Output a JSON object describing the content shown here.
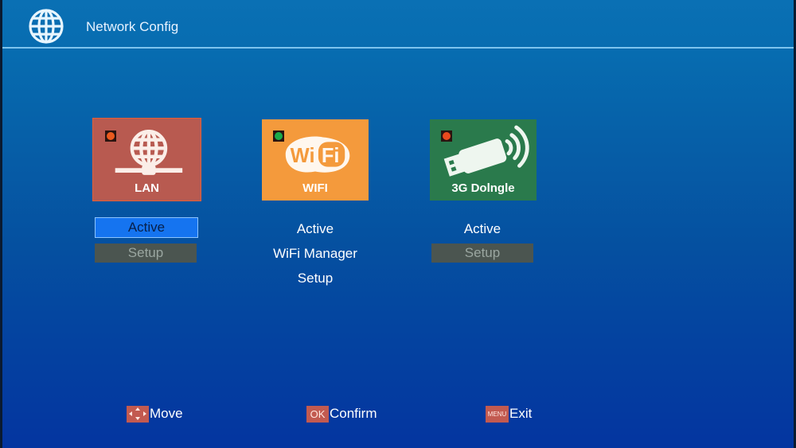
{
  "header": {
    "title": "Network Config",
    "icon": "globe-icon"
  },
  "tiles": [
    {
      "label": "LAN",
      "icon": "lan-globe-icon",
      "color": "#b85a50",
      "status_color": "#ea5a1e",
      "selected": true,
      "options": [
        "Active",
        "Setup"
      ]
    },
    {
      "label": "WIFI",
      "icon": "wifi-logo-icon",
      "color": "#f49a3c",
      "status_color": "#1cab4a",
      "selected": false,
      "options": [
        "Active",
        "WiFi Manager",
        "Setup"
      ]
    },
    {
      "label": "3G Dolngle",
      "icon": "usb-dongle-icon",
      "color": "#2a7a4c",
      "status_color": "#ea4a1e",
      "selected": false,
      "options": [
        "Active",
        "Setup"
      ]
    }
  ],
  "footer": [
    {
      "key": "",
      "key_icon": "arrows-icon",
      "label": "Move"
    },
    {
      "key": "OK",
      "label": "Confirm"
    },
    {
      "key": "MENU",
      "label": "Exit"
    }
  ],
  "colors": {
    "selected_bg": "#1574f0",
    "disabled_bg": "#4b5550",
    "key_bg": "#c25a50"
  }
}
